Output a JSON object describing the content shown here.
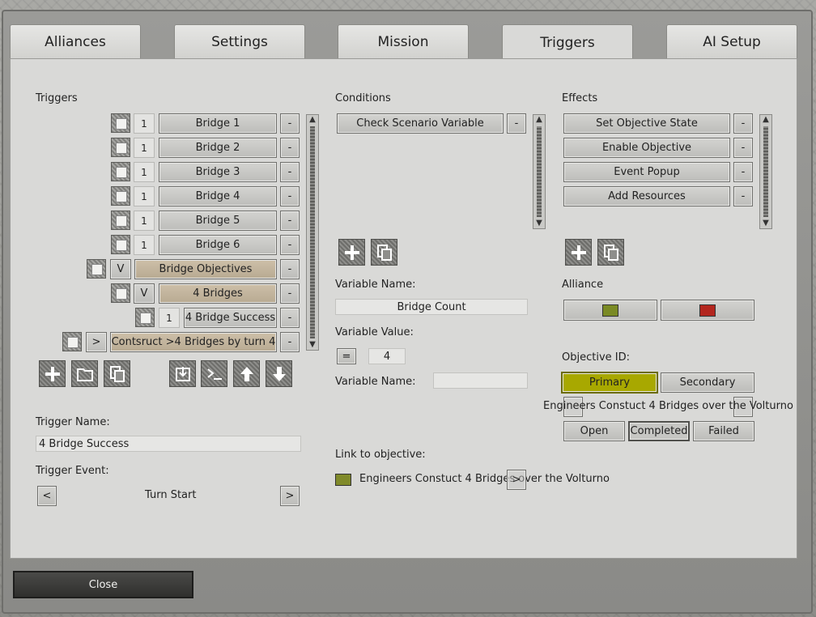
{
  "tabs": [
    "Alliances",
    "Settings",
    "Mission",
    "Triggers",
    "AI Setup"
  ],
  "active_tab": "Triggers",
  "triggers": {
    "header": "Triggers",
    "items": [
      {
        "flag": "1",
        "label": "Bridge 1",
        "style": "gray",
        "remove": "-"
      },
      {
        "flag": "1",
        "label": "Bridge 2",
        "style": "gray",
        "remove": "-"
      },
      {
        "flag": "1",
        "label": "Bridge 3",
        "style": "gray",
        "remove": "-"
      },
      {
        "flag": "1",
        "label": "Bridge 4",
        "style": "gray",
        "remove": "-"
      },
      {
        "flag": "1",
        "label": "Bridge 5",
        "style": "gray",
        "remove": "-"
      },
      {
        "flag": "1",
        "label": "Bridge 6",
        "style": "gray",
        "remove": "-"
      },
      {
        "flag": "V",
        "label": "Bridge Objectives",
        "style": "tan",
        "remove": "-"
      },
      {
        "flag": "V",
        "label": "4 Bridges",
        "style": "tan",
        "remove": "-"
      },
      {
        "flag": "1",
        "label": "4 Bridge Success",
        "style": "gray",
        "remove": "-"
      },
      {
        "flag": ">",
        "label": "Contsruct  >4 Bridges by turn 4",
        "style": "tan",
        "remove": "-"
      }
    ],
    "trigger_name_label": "Trigger Name:",
    "trigger_name_value": "4 Bridge Success",
    "trigger_event_label": "Trigger Event:",
    "trigger_event_value": "Turn Start",
    "prev": "<",
    "next": ">"
  },
  "conditions": {
    "header": "Conditions",
    "items": [
      {
        "label": "Check Scenario Variable",
        "remove": "-"
      }
    ],
    "variable_name_label": "Variable Name:",
    "variable_name_value": "Bridge Count",
    "variable_value_label": "Variable Value:",
    "operator": "=",
    "variable_value": "4",
    "variable_name2_label": "Variable Name:",
    "variable_name2_value": "",
    "link_label": "Link to objective:",
    "link_value": "Engineers Constuct 4 Bridges over the Volturno",
    "link_button": ">"
  },
  "effects": {
    "header": "Effects",
    "items": [
      {
        "label": "Set Objective State",
        "remove": "-"
      },
      {
        "label": "Enable Objective",
        "remove": "-"
      },
      {
        "label": "Event Popup",
        "remove": "-"
      },
      {
        "label": "Add Resources",
        "remove": "-"
      }
    ],
    "alliance_label": "Alliance",
    "alliance_colors": [
      "#7a8a24",
      "#b3261e"
    ],
    "objective_id_label": "Objective ID:",
    "primary": "Primary",
    "secondary": "Secondary",
    "objective_text": "Engineers Constuct 4 Bridges over the Volturno",
    "states": [
      "Open",
      "Completed",
      "Failed"
    ]
  },
  "colors": {
    "primary_highlight": "#a8a800",
    "link_swatch": "#808a2a"
  },
  "close": "Close"
}
